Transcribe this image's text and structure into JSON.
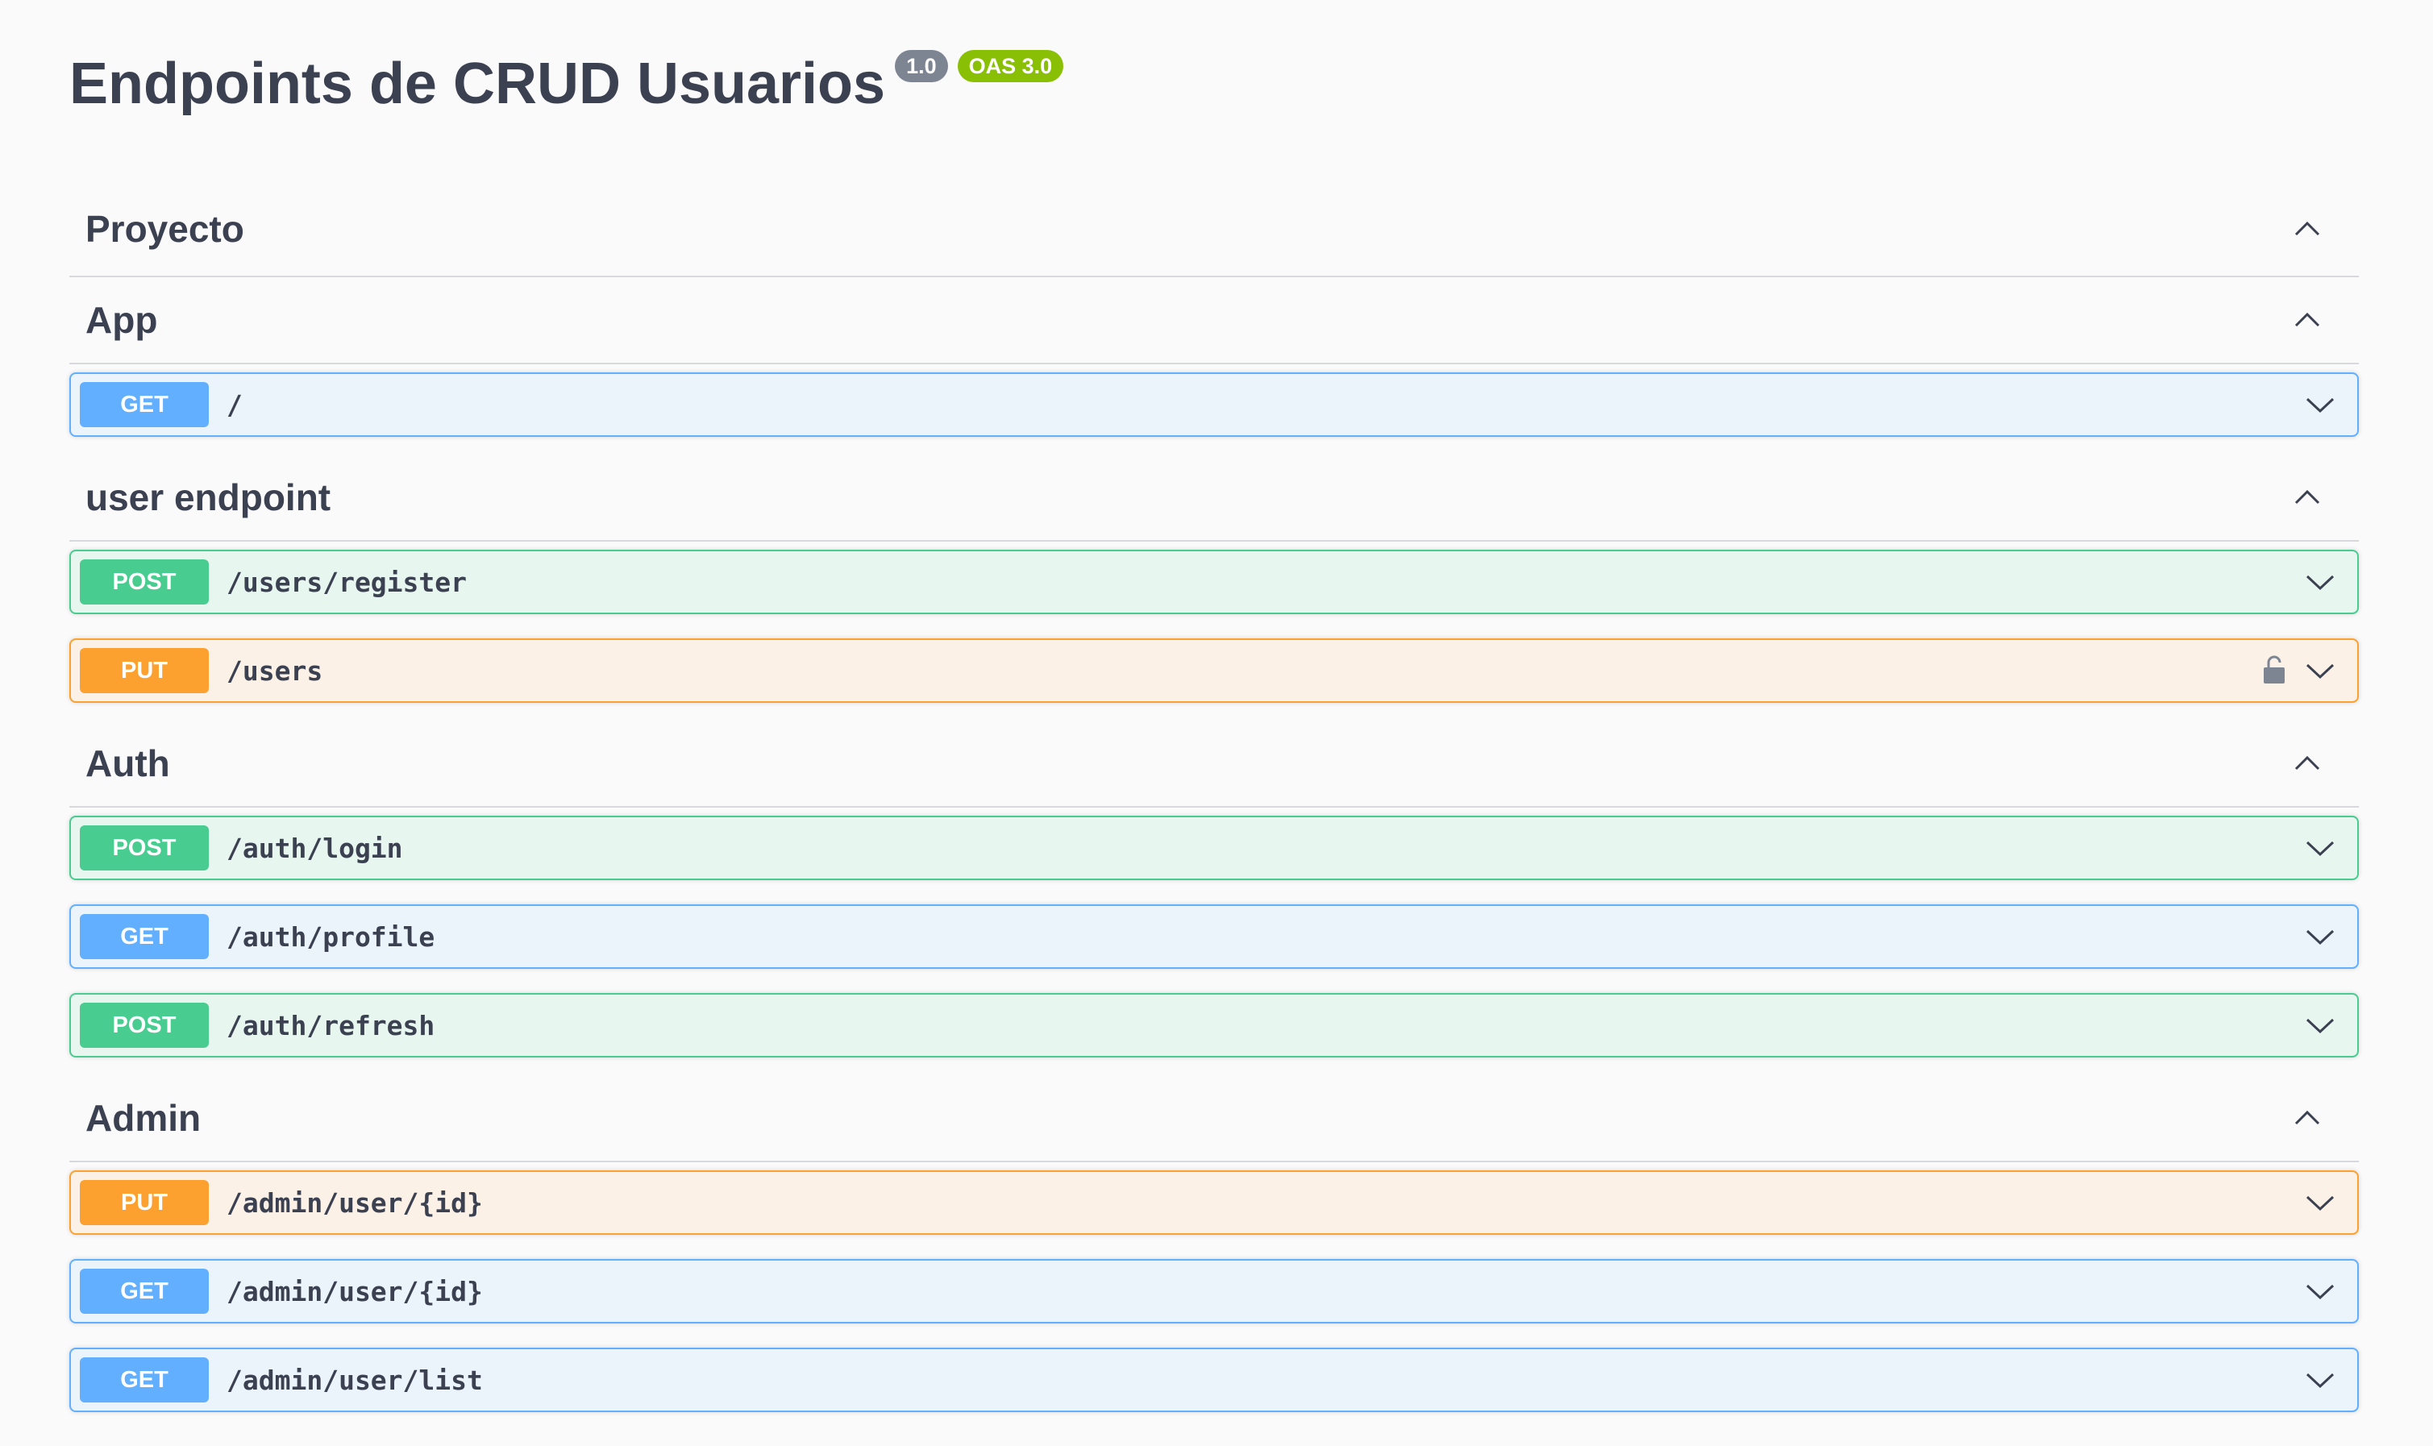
{
  "header": {
    "title": "Endpoints de CRUD Usuarios",
    "version_badge": "1.0",
    "oas_badge": "OAS 3.0"
  },
  "colors": {
    "get": "#61affe",
    "post": "#49cc90",
    "put": "#fca130",
    "version_badge": "#7d8492",
    "oas_badge": "#89bf04"
  },
  "sections": [
    {
      "name": "Proyecto",
      "expanded_icon": "chevron-up-icon",
      "operations": []
    },
    {
      "name": "App",
      "expanded_icon": "chevron-up-icon",
      "operations": [
        {
          "method": "GET",
          "path": "/",
          "locked": false,
          "icon": "chevron-down-icon"
        }
      ]
    },
    {
      "name": "user endpoint",
      "expanded_icon": "chevron-up-icon",
      "operations": [
        {
          "method": "POST",
          "path": "/users/register",
          "locked": false,
          "icon": "chevron-down-icon"
        },
        {
          "method": "PUT",
          "path": "/users",
          "locked": true,
          "icon": "chevron-down-icon"
        }
      ]
    },
    {
      "name": "Auth",
      "expanded_icon": "chevron-up-icon",
      "operations": [
        {
          "method": "POST",
          "path": "/auth/login",
          "locked": false,
          "icon": "chevron-down-icon"
        },
        {
          "method": "GET",
          "path": "/auth/profile",
          "locked": false,
          "icon": "chevron-down-icon"
        },
        {
          "method": "POST",
          "path": "/auth/refresh",
          "locked": false,
          "icon": "chevron-down-icon"
        }
      ]
    },
    {
      "name": "Admin",
      "expanded_icon": "chevron-up-icon",
      "operations": [
        {
          "method": "PUT",
          "path": "/admin/user/{id}",
          "locked": false,
          "icon": "chevron-down-icon"
        },
        {
          "method": "GET",
          "path": "/admin/user/{id}",
          "locked": false,
          "icon": "chevron-down-icon"
        },
        {
          "method": "GET",
          "path": "/admin/user/list",
          "locked": false,
          "icon": "chevron-down-icon"
        }
      ]
    }
  ]
}
